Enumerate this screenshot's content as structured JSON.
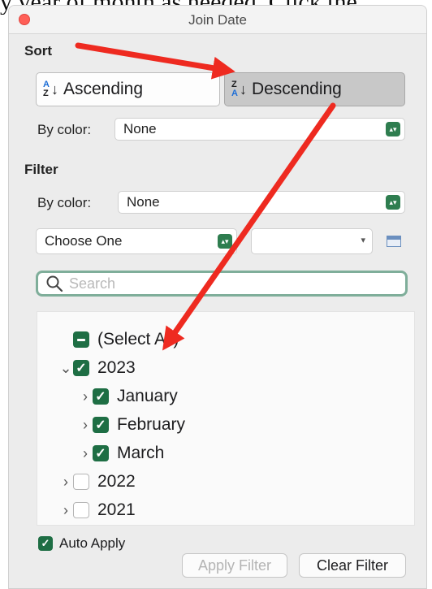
{
  "document_snippet": "y year of month as needed. Click the",
  "window": {
    "title": "Join Date"
  },
  "sort": {
    "label": "Sort",
    "ascending_label": "Ascending",
    "ascending_icon_top": "A",
    "ascending_icon_bottom": "Z",
    "descending_label": "Descending",
    "descending_icon_top": "Z",
    "descending_icon_bottom": "A",
    "sort_arrow": "↓",
    "by_color_label": "By color:",
    "by_color_value": "None"
  },
  "filter": {
    "label": "Filter",
    "by_color_label": "By color:",
    "by_color_value": "None",
    "condition_value": "Choose One",
    "condition_input_value": "",
    "search_placeholder": "Search"
  },
  "tree": {
    "select_all": "(Select All)",
    "year_2023": "2023",
    "jan": "January",
    "feb": "February",
    "mar": "March",
    "year_2022": "2022",
    "year_2021": "2021"
  },
  "footer": {
    "auto_apply_label": "Auto Apply",
    "apply_label": "Apply Filter",
    "clear_label": "Clear Filter"
  },
  "colors": {
    "accent_green": "#1e6e44",
    "annotation_red": "#ee2a20",
    "close_red": "#ff5f57"
  },
  "icons": {
    "close": "close-dot-icon",
    "search": "search-icon",
    "calendar": "calendar-icon",
    "stepper": "stepper-icon",
    "chevron_down": "chevron-down-icon",
    "chevron_right": "chevron-right-icon",
    "checkmark": "check-icon"
  }
}
